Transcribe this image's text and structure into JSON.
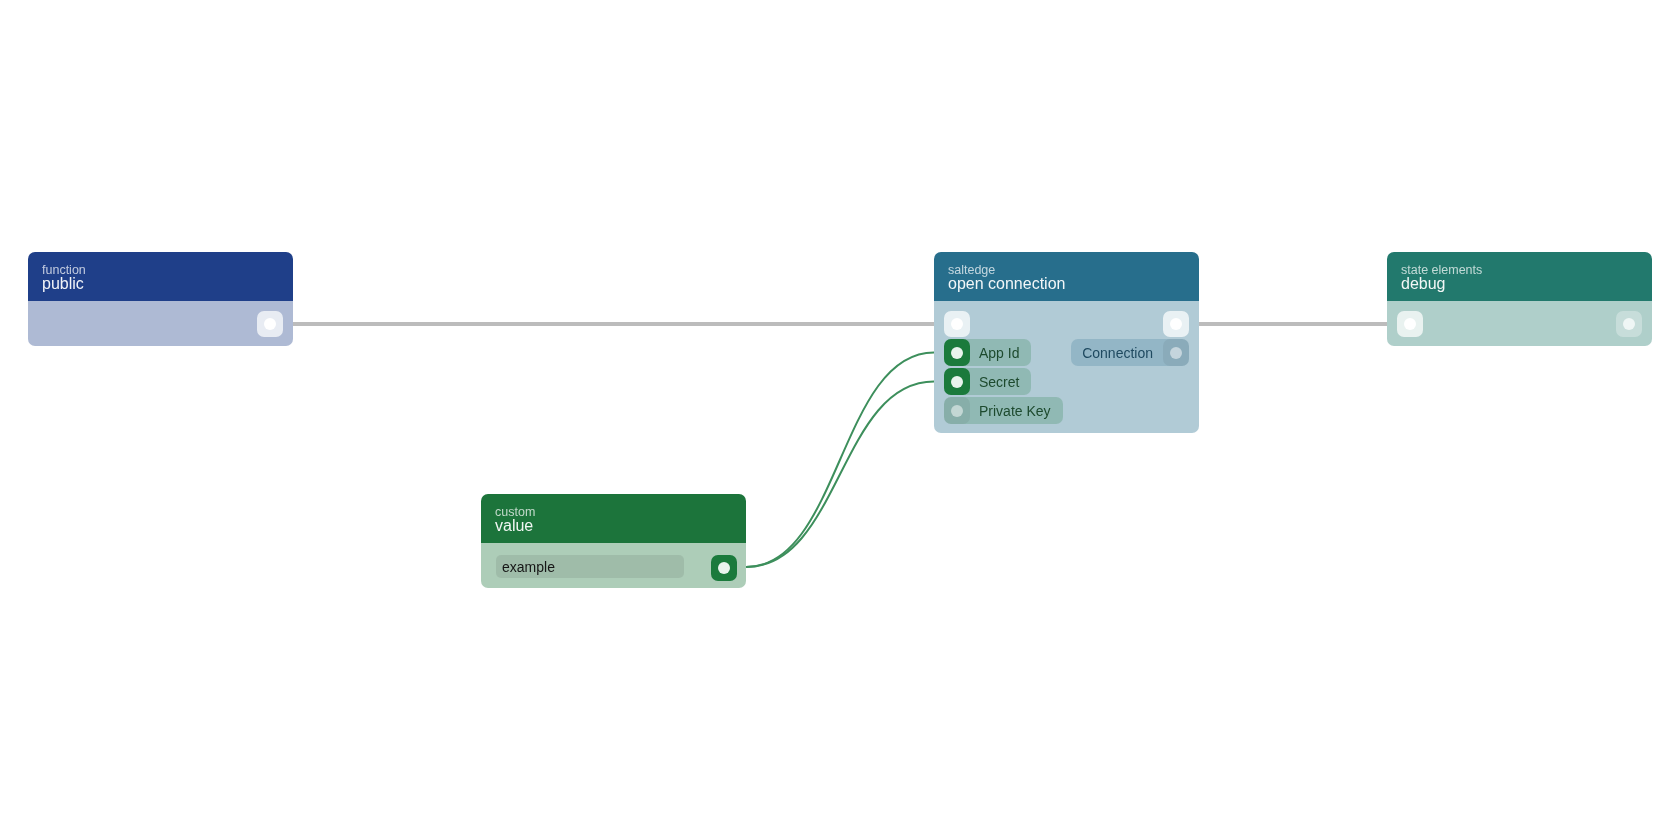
{
  "nodes": [
    {
      "category": "function",
      "title": "public",
      "color": "#1f3f89",
      "exec_out": {
        "connected": true
      }
    },
    {
      "category": "saltedge",
      "title": "open connection",
      "color": "#276e8c",
      "exec_in": {
        "connected": true
      },
      "exec_out": {
        "connected": true
      },
      "inputs": [
        {
          "label": "App Id",
          "connected": true
        },
        {
          "label": "Secret",
          "connected": true
        },
        {
          "label": "Private Key",
          "connected": false
        }
      ],
      "outputs": [
        {
          "label": "Connection",
          "connected": false
        }
      ]
    },
    {
      "category": "state elements",
      "title": "debug",
      "color": "#22796d",
      "exec_in": {
        "connected": true
      },
      "exec_out": {
        "connected": false
      }
    },
    {
      "category": "custom",
      "title": "value",
      "color": "#1c743b",
      "field": {
        "value": "example"
      },
      "outputs": [
        {
          "connected": true
        }
      ]
    }
  ],
  "wires": [
    {
      "kind": "exec"
    },
    {
      "kind": "exec"
    },
    {
      "kind": "data"
    },
    {
      "kind": "data"
    }
  ]
}
